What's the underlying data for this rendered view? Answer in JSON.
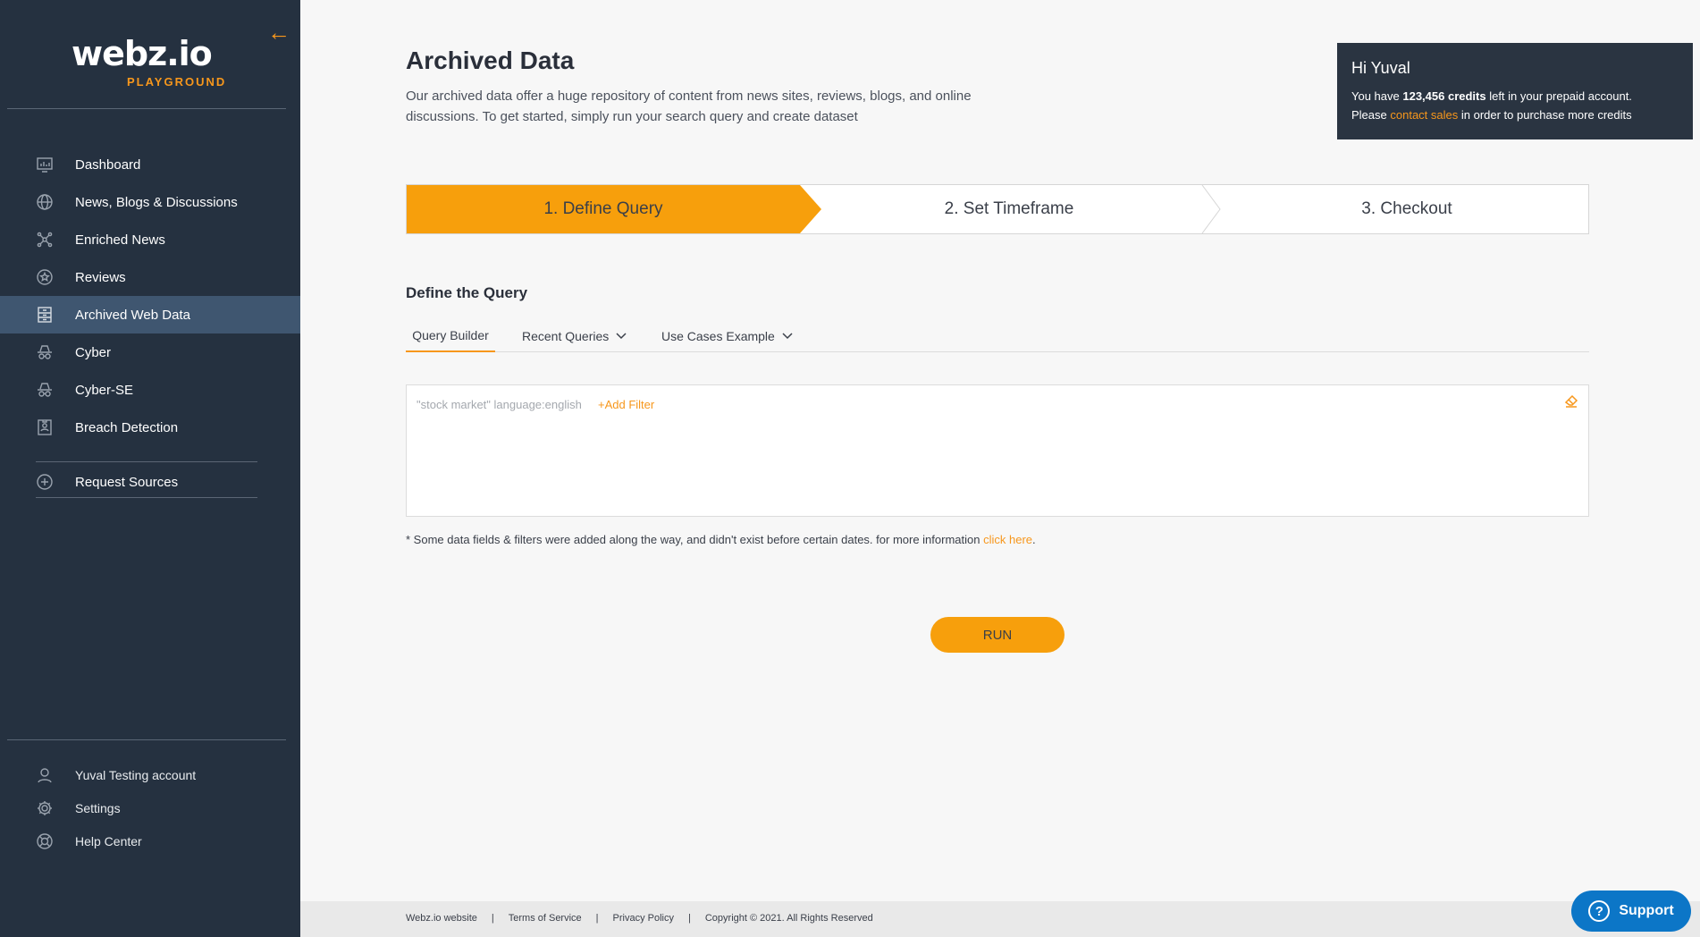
{
  "sidebar": {
    "logo_main": "webz.io",
    "logo_sub": "PLAYGROUND",
    "collapse_icon": "arrow-left-icon",
    "items": [
      {
        "label": "Dashboard",
        "icon": "chart-icon"
      },
      {
        "label": "News, Blogs & Discussions",
        "icon": "globe-icon"
      },
      {
        "label": "Enriched News",
        "icon": "network-icon"
      },
      {
        "label": "Reviews",
        "icon": "star-icon"
      },
      {
        "label": "Archived Web Data",
        "icon": "archive-icon",
        "active": true
      },
      {
        "label": "Cyber",
        "icon": "spy-icon"
      },
      {
        "label": "Cyber-SE",
        "icon": "spy-icon"
      },
      {
        "label": "Breach Detection",
        "icon": "badge-icon"
      }
    ],
    "request_sources": {
      "label": "Request Sources",
      "icon": "plus-circle-icon"
    },
    "bottom_items": [
      {
        "label": "Yuval Testing account",
        "icon": "user-icon"
      },
      {
        "label": "Settings",
        "icon": "gear-icon"
      },
      {
        "label": "Help Center",
        "icon": "lifebuoy-icon"
      }
    ]
  },
  "main": {
    "title": "Archived Data",
    "description": "Our archived data offer a huge repository of content from news sites, reviews, blogs, and online discussions. To get started, simply run your search query and create dataset",
    "credits": {
      "greeting": "Hi Yuval",
      "line1_prefix": "You have ",
      "credits_amount": "123,456 credits",
      "line1_suffix": " left in your prepaid account.",
      "line2_prefix": "Please ",
      "contact_link": "contact sales",
      "line2_suffix": " in order to purchase more credits"
    },
    "steps": [
      "1. Define Query",
      "2. Set Timeframe",
      "3. Checkout"
    ],
    "section_title": "Define the Query",
    "tabs": [
      {
        "label": "Query Builder",
        "active": true
      },
      {
        "label": "Recent Queries"
      },
      {
        "label": "Use Cases Example"
      }
    ],
    "query": {
      "text": "\"stock market\" language:english",
      "add_filter": "+Add Filter"
    },
    "note_prefix": "*  Some data fields & filters were added along the way, and didn't exist before certain dates. for more information ",
    "note_link": "click here",
    "note_suffix": ".",
    "run_label": "RUN"
  },
  "footer": {
    "links": [
      "Webz.io website",
      "Terms of Service",
      "Privacy Policy"
    ],
    "copyright": "Copyright © 2021. All Rights Reserved"
  },
  "support": {
    "label": "Support",
    "icon": "question-icon"
  },
  "colors": {
    "sidebar_bg": "#253140",
    "accent": "#f79f0c",
    "active_item": "#3f5670",
    "support": "#0c76c7"
  }
}
